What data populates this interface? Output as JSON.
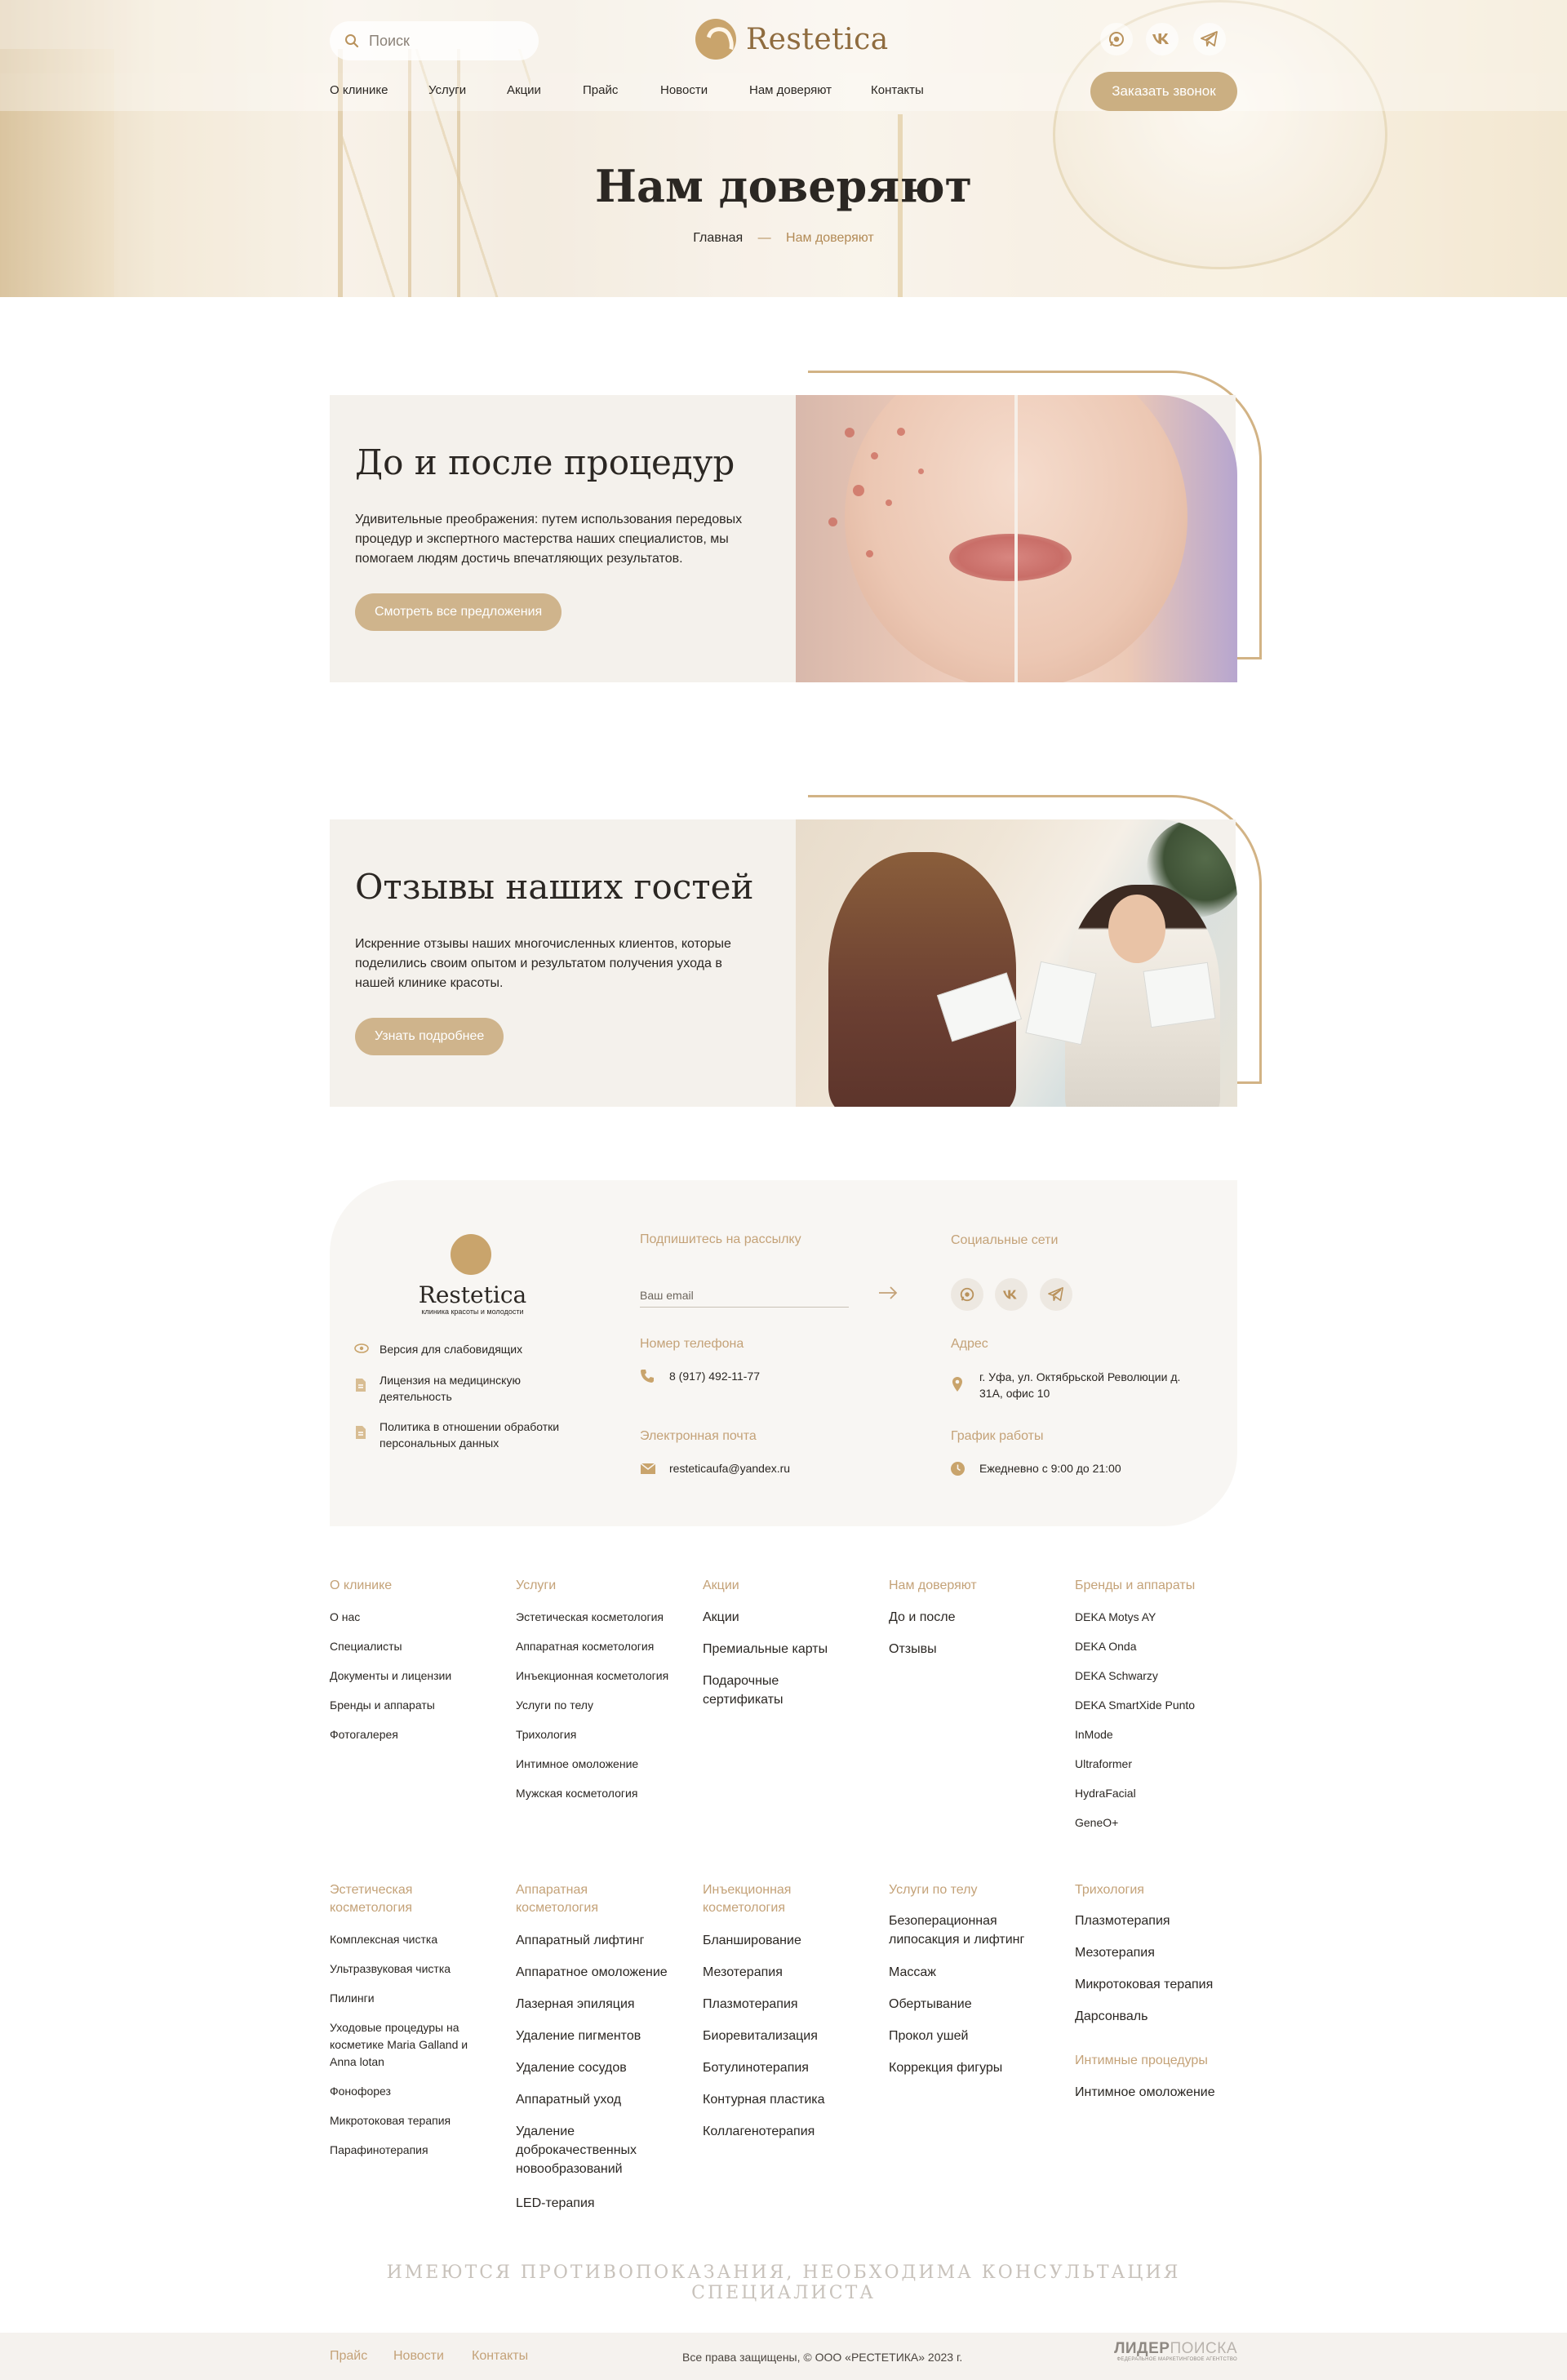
{
  "header": {
    "search_placeholder": "Поиск",
    "logo_text": "Restetica",
    "social": [
      "whatsapp-icon",
      "vk-icon",
      "telegram-icon"
    ],
    "nav": [
      "О клинике",
      "Услуги",
      "Акции",
      "Прайс",
      "Новости",
      "Нам доверяют",
      "Контакты"
    ],
    "call_button": "Заказать звонок"
  },
  "hero": {
    "title": "Нам доверяют",
    "breadcrumb": {
      "home": "Главная",
      "separator": "—",
      "current": "Нам доверяют"
    }
  },
  "cards": [
    {
      "title": "До и после процедур",
      "text": "Удивительные преображения: путем использования передовых процедур и экспертного мастерства наших специалистов, мы помогаем людям достичь впечатляющих результатов.",
      "button": "Смотреть все предложения"
    },
    {
      "title": "Отзывы наших гостей",
      "text": "Искренние отзывы наших многочисленных клиентов, которые поделились своим опытом и результатом получения ухода в нашей клинике красоты.",
      "button": "Узнать подробнее"
    }
  ],
  "footer": {
    "logo_text": "Restetica",
    "logo_sub": "клиника красоты и молодости",
    "links": [
      {
        "icon": "eye-icon",
        "label": "Версия для слабовидящих"
      },
      {
        "icon": "document-icon",
        "label": "Лицензия на медицинскую деятельность"
      },
      {
        "icon": "document-icon",
        "label": "Политика в отношении обработки персональных данных"
      }
    ],
    "subscribe_title": "Подпишитесь на рассылку",
    "email_placeholder": "Ваш email",
    "social_title": "Социальные сети",
    "phone_title": "Номер телефона",
    "phone": "8 (917) 492-11-77",
    "address_title": "Адрес",
    "address": "г. Уфа, ул. Октябрьской Революции д. 31А, офис 10",
    "email_title": "Электронная почта",
    "email": "resteticaufa@yandex.ru",
    "hours_title": "График работы",
    "hours": "Ежедневно с 9:00 до 21:00"
  },
  "sitemap_top": [
    {
      "title": "О клинике",
      "items": [
        "О нас",
        "Специалисты",
        "Документы и лицензии",
        "Бренды и аппараты",
        "Фотогалерея"
      ]
    },
    {
      "title": "Услуги",
      "items": [
        "Эстетическая косметология",
        "Аппаратная косметология",
        "Инъекционная косметология",
        "Услуги по телу",
        "Трихология",
        "Интимное омоложение",
        "Мужская косметология"
      ]
    },
    {
      "title": "Акции",
      "items": [
        "Акции",
        "Премиальные карты",
        "Подарочные сертификаты"
      ]
    },
    {
      "title": "Нам доверяют",
      "items": [
        "До и после",
        "Отзывы"
      ]
    },
    {
      "title": "Бренды и аппараты",
      "items": [
        "DEKA Motys AY",
        "DEKA Onda",
        "DEKA Schwarzy",
        "DEKA SmartXide Punto",
        "InMode",
        "Ultraformer",
        "HydraFacial",
        "GeneO+"
      ]
    }
  ],
  "sitemap_bottom": [
    {
      "title": "Эстетическая косметология",
      "items": [
        "Комплексная чистка",
        "Ультразвуковая чистка",
        "Пилинги",
        "Уходовые процедуры на косметике Maria Galland и Anna lotan",
        "Фонофорез",
        "Микротоковая терапия",
        "Парафинотерапия"
      ]
    },
    {
      "title": "Аппаратная косметология",
      "items": [
        "Аппаратный лифтинг",
        "Аппаратное омоложение",
        "Лазерная эпиляция",
        "Удаление пигментов",
        "Удаление сосудов",
        "Аппаратный уход",
        "Удаление доброкачественных новообразований",
        "LED-терапия"
      ]
    },
    {
      "title": "Инъекционная косметология",
      "items": [
        "Бланширование",
        "Мезотерапия",
        "Плазмотерапия",
        "Биоревитализация",
        "Ботулинотерапия",
        "Контурная пластика",
        "Коллагенотерапия"
      ]
    },
    {
      "title": "Услуги по телу",
      "items": [
        "Безоперационная липосакция и лифтинг",
        "Массаж",
        "Обертывание",
        "Прокол ушей",
        "Коррекция фигуры"
      ]
    },
    {
      "title": "Трихология",
      "items": [
        "Плазмотерапия",
        "Мезотерапия",
        "Микротоковая терапия",
        "Дарсонваль"
      ],
      "title2": "Интимные процедуры",
      "items2": [
        "Интимное омоложение"
      ]
    }
  ],
  "disclaimer": "ИМЕЮТСЯ ПРОТИВОПОКАЗАНИЯ, НЕОБХОДИМА КОНСУЛЬТАЦИЯ СПЕЦИАЛИСТА",
  "bottom_bar": {
    "links": [
      "Прайс",
      "Новости",
      "Контакты"
    ],
    "copyright": "Все права защищены, © ООО «РЕСТЕТИКА» 2023 г.",
    "dev_logo_main": "ЛИДЕР",
    "dev_logo_accent": "ПОИСКА",
    "dev_logo_sub": "ФЕДЕРАЛЬНОЕ МАРКЕТИНГОВОЕ АГЕНТСТВО"
  },
  "colors": {
    "accent": "#cbaf82",
    "accent_text": "#c4a278",
    "card_bg": "#f4f1ec",
    "footer_bg": "#f8f6f3"
  }
}
